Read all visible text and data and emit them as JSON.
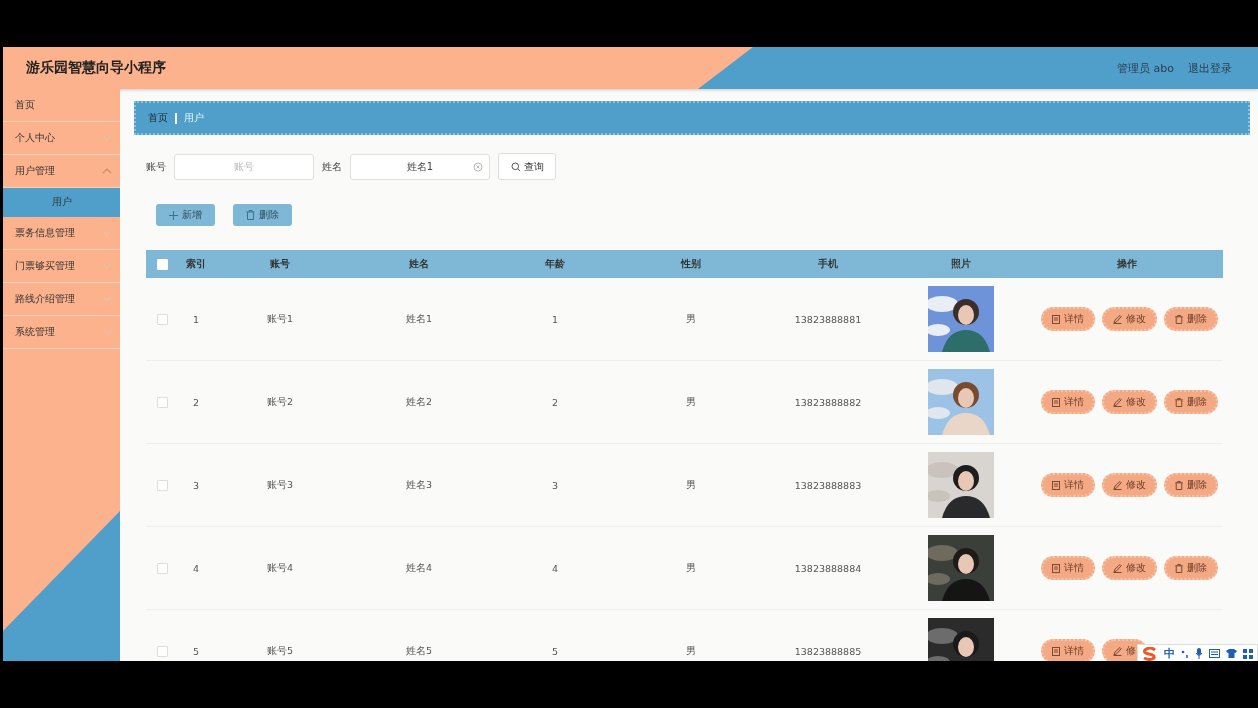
{
  "header": {
    "title": "游乐园智慧向导小程序",
    "user": "管理员 abo",
    "logout": "退出登录"
  },
  "sidebar": {
    "items": [
      {
        "label": "首页",
        "kind": "link"
      },
      {
        "label": "个人中心",
        "kind": "group",
        "expanded": false
      },
      {
        "label": "用户管理",
        "kind": "group",
        "expanded": true,
        "children": [
          {
            "label": "用户",
            "selected": true
          }
        ]
      },
      {
        "label": "票务信息管理",
        "kind": "group",
        "expanded": false
      },
      {
        "label": "门票够买管理",
        "kind": "group",
        "expanded": false
      },
      {
        "label": "路线介绍管理",
        "kind": "group",
        "expanded": false
      },
      {
        "label": "系统管理",
        "kind": "group",
        "expanded": false
      }
    ]
  },
  "breadcrumb": [
    "首页",
    "用户"
  ],
  "search": {
    "fields": [
      {
        "label": "账号",
        "placeholder": "账号"
      },
      {
        "label": "姓名",
        "value": "姓名1"
      }
    ],
    "button": "查询"
  },
  "actions": [
    {
      "label": "新增",
      "kind": "add"
    },
    {
      "label": "删除",
      "kind": "delete"
    }
  ],
  "table": {
    "select_all": {
      "checked": false
    },
    "columns": [
      "索引",
      "账号",
      "姓名",
      "年龄",
      "性别",
      "手机",
      "照片",
      "操作"
    ],
    "rows": [
      {
        "checked": false,
        "cells": [
          "1",
          "账号1",
          "姓名1",
          "1",
          "男",
          "13823888881"
        ],
        "photo": {
          "kind": "picture"
        },
        "buttons": [
          {
            "label": "详情",
            "kind": "detail"
          },
          {
            "label": "修改",
            "kind": "edit"
          },
          {
            "label": "删除",
            "kind": "delete"
          }
        ]
      },
      {
        "checked": false,
        "cells": [
          "2",
          "账号2",
          "姓名2",
          "2",
          "男",
          "13823888882"
        ],
        "photo": {
          "kind": "picture"
        },
        "buttons": [
          {
            "label": "详情",
            "kind": "detail"
          },
          {
            "label": "修改",
            "kind": "edit"
          },
          {
            "label": "删除",
            "kind": "delete"
          }
        ]
      },
      {
        "checked": false,
        "cells": [
          "3",
          "账号3",
          "姓名3",
          "3",
          "男",
          "13823888883"
        ],
        "photo": {
          "kind": "picture"
        },
        "buttons": [
          {
            "label": "详情",
            "kind": "detail"
          },
          {
            "label": "修改",
            "kind": "edit"
          },
          {
            "label": "删除",
            "kind": "delete"
          }
        ]
      },
      {
        "checked": false,
        "cells": [
          "4",
          "账号4",
          "姓名4",
          "4",
          "男",
          "13823888884"
        ],
        "photo": {
          "kind": "picture"
        },
        "buttons": [
          {
            "label": "详情",
            "kind": "detail"
          },
          {
            "label": "修改",
            "kind": "edit"
          },
          {
            "label": "删除",
            "kind": "delete"
          }
        ]
      },
      {
        "checked": false,
        "cells": [
          "5",
          "账号5",
          "姓名5",
          "5",
          "男",
          "13823888885"
        ],
        "photo": {
          "kind": "picture"
        },
        "buttons": [
          {
            "label": "详情",
            "kind": "detail"
          },
          {
            "label": "修",
            "kind": "edit"
          }
        ]
      }
    ]
  },
  "ime_toolbar": {
    "mode": "中"
  }
}
